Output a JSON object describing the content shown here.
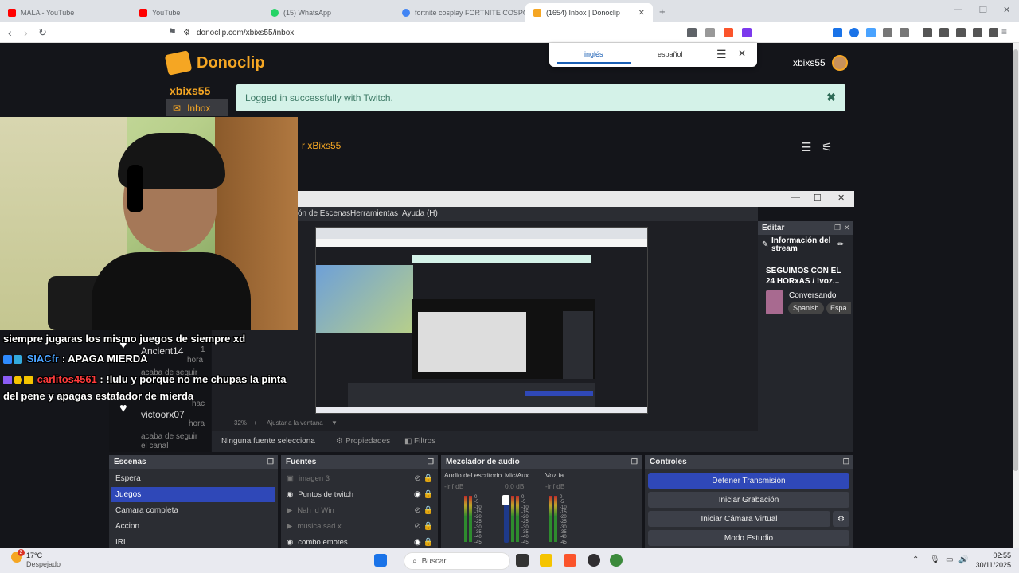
{
  "tabs": [
    {
      "label": "MALA - YouTube",
      "color": "#ff0000"
    },
    {
      "label": "YouTube",
      "color": "#ff0000"
    },
    {
      "label": "(15) WhatsApp",
      "color": "#25d366"
    },
    {
      "label": "fortnite cosplay FORTNITE COSPOR",
      "color": "#4285f4"
    },
    {
      "label": "(1654) Inbox | Donoclip",
      "color": "#f5a623"
    }
  ],
  "browser": {
    "url": "donoclip.com/xbixs55/inbox"
  },
  "translate": {
    "lang1": "inglés",
    "lang2": "español"
  },
  "donoclip": {
    "brand": "Donoclip",
    "user_top": "xbixs55",
    "sidebar_user": "xbixs55",
    "inbox_label": "Inbox",
    "alert": "Logged in successfully with Twitch.",
    "channel_text": "r xBixs55"
  },
  "chat": {
    "line1": "siempre jugaras los mismo juegos de siempre xd",
    "user2": "SIACfr",
    "msg2": ": APAGA MIERDA",
    "user3": "carlitos4561",
    "msg3": ": !lulu y porque no me chupas la pinta",
    "msg3b": "del pene y apagas estafador de mierda"
  },
  "alerts": {
    "a1_name": "Ancient14",
    "a1_num": "1",
    "a1_time": "hora",
    "a1_sub": "acaba de seguir",
    "a2_name": "victoorx07",
    "a2_time": "hora",
    "a2_sub": "acaba de seguir",
    "a2_sub2": "el canal",
    "a2_hace": "hac"
  },
  "obs": {
    "menu": [
      "ón de Escenas",
      "Herramientas",
      "Ayuda (H)"
    ],
    "zoom": "32%",
    "fit": "Ajustar a la ventana",
    "no_source": "Ninguna fuente selecciona",
    "props": "Propiedades",
    "filters": "Filtros",
    "edit_title": "Editar",
    "stream_info": "Información del stream",
    "stream_title": "SEGUIMOS CON EL 24 HORxAS / !voz...",
    "category": "Conversando",
    "tags": [
      "Spanish",
      "Espa"
    ],
    "scenes_title": "Escenas",
    "scenes": [
      "Espera",
      "Juegos",
      "Camara completa",
      "Accion",
      "IRL"
    ],
    "sources_title": "Fuentes",
    "sources": [
      {
        "name": "imagen 3",
        "visible": false
      },
      {
        "name": "Puntos de twitch",
        "visible": true
      },
      {
        "name": "Nah id Win",
        "visible": false
      },
      {
        "name": "musica sad x",
        "visible": false
      },
      {
        "name": "combo emotes",
        "visible": true
      }
    ],
    "mixer_title": "Mezclador de audio",
    "mixer": [
      {
        "name": "Audio del escritorio",
        "db": "-inf dB"
      },
      {
        "name": "Mic/Aux",
        "db": "0.0 dB"
      },
      {
        "name": "Voz ia",
        "db": "-inf dB"
      }
    ],
    "meter_scale": [
      "0",
      "-5",
      "-10",
      "-15",
      "-20",
      "-25",
      "-30",
      "-35",
      "-40",
      "-45"
    ],
    "controls_title": "Controles",
    "controls": [
      "Detener Transmisión",
      "Iniciar Grabación",
      "Iniciar Cámara Virtual",
      "Modo Estudio"
    ]
  },
  "taskbar": {
    "temp": "17°C",
    "weather": "Despejado",
    "search": "Buscar",
    "time": "02:55",
    "date": "30/11/2025",
    "badge": "2"
  }
}
